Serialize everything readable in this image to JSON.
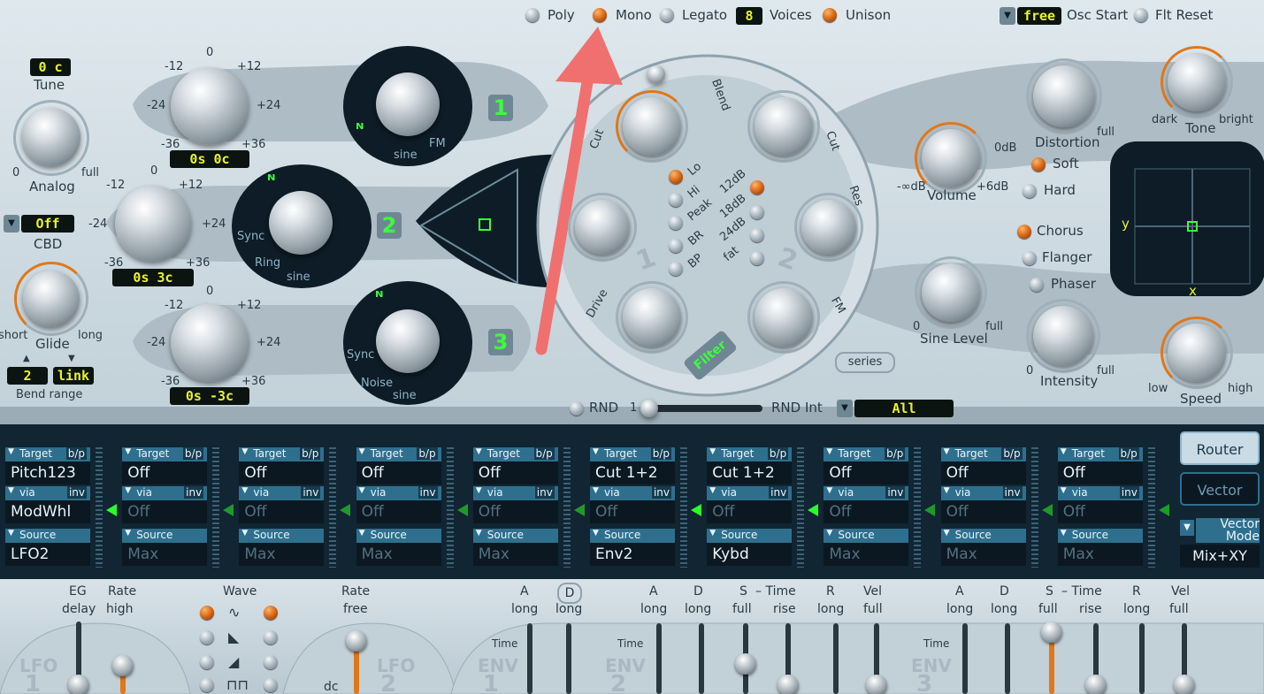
{
  "top_bar": {
    "poly": "Poly",
    "mono": "Mono",
    "legato": "Legato",
    "voices_value": "8",
    "voices_label": "Voices",
    "unison": "Unison",
    "osc_start_value": "free",
    "osc_start_label": "Osc Start",
    "flt_reset": "Flt Reset"
  },
  "left_panel": {
    "tune_value": "0 c",
    "tune_label": "Tune",
    "analog_label": "Analog",
    "analog_min": "0",
    "analog_max": "full",
    "cbd_value": "Off",
    "cbd_label": "CBD",
    "glide_label": "Glide",
    "glide_min": "short",
    "glide_max": "long",
    "bend_down": "2",
    "bend_up": "link",
    "bend_label": "Bend range"
  },
  "oscillators": {
    "osc1": {
      "number": "1",
      "readout": "0s  0c",
      "wave": "sine",
      "fm": "FM",
      "scale": [
        "-12",
        "0",
        "+12",
        "-24",
        "+24",
        "-36",
        "+36"
      ]
    },
    "osc2": {
      "number": "2",
      "readout": "0s  3c",
      "wave": "sine",
      "sync": "Sync",
      "ring": "Ring",
      "scale": [
        "-12",
        "0",
        "+12",
        "-24",
        "+24",
        "-36",
        "+36"
      ]
    },
    "osc3": {
      "number": "3",
      "readout": "0s  -3c",
      "wave": "sine",
      "sync": "Sync",
      "noise": "Noise",
      "scale": [
        "-12",
        "0",
        "+12",
        "-24",
        "+24",
        "-36",
        "+36"
      ]
    }
  },
  "filter": {
    "blend": "Blend",
    "cut1": "Cut",
    "cut2": "Cut",
    "res1": "Res",
    "res2": "Res",
    "drive": "Drive",
    "fm": "FM",
    "filter_badge": "Filter",
    "series": "series",
    "modes": [
      "Lo",
      "Hi",
      "Peak",
      "BR",
      "BP"
    ],
    "slopes": [
      "12dB",
      "18dB",
      "24dB",
      "fat"
    ],
    "num1": "1",
    "num2": "2"
  },
  "rnd": {
    "label": "RND",
    "min": "1",
    "int_label": "RND Int",
    "target": "All"
  },
  "right_panel": {
    "volume_label": "Volume",
    "volume_min": "-∞dB",
    "volume_mid": "0dB",
    "volume_max": "+6dB",
    "sine_level_label": "Sine Level",
    "sine_min": "0",
    "sine_max": "full",
    "distortion_label": "Distortion",
    "dist_max": "full",
    "soft": "Soft",
    "hard": "Hard",
    "tone_label": "Tone",
    "tone_min": "dark",
    "tone_max": "bright",
    "chorus": "Chorus",
    "flanger": "Flanger",
    "phaser": "Phaser",
    "intensity_label": "Intensity",
    "intensity_min": "0",
    "intensity_max": "full",
    "speed_label": "Speed",
    "speed_min": "low",
    "speed_max": "high",
    "xy_x": "x",
    "xy_y": "y"
  },
  "mod_matrix": {
    "header_target": "Target",
    "header_bp": "b/p",
    "header_via": "via",
    "header_inv": "inv",
    "header_source": "Source",
    "slots": [
      {
        "target": "Pitch123",
        "via": "ModWhl",
        "source": "LFO2",
        "active": true
      },
      {
        "target": "Off",
        "via": "Off",
        "source": "Max",
        "active": false
      },
      {
        "target": "Off",
        "via": "Off",
        "source": "Max",
        "active": false
      },
      {
        "target": "Off",
        "via": "Off",
        "source": "Max",
        "active": false
      },
      {
        "target": "Off",
        "via": "Off",
        "source": "Max",
        "active": false
      },
      {
        "target": "Cut 1+2",
        "via": "Off",
        "source": "Env2",
        "active": true
      },
      {
        "target": "Cut 1+2",
        "via": "Off",
        "source": "Kybd",
        "active": true
      },
      {
        "target": "Off",
        "via": "Off",
        "source": "Max",
        "active": false
      },
      {
        "target": "Off",
        "via": "Off",
        "source": "Max",
        "active": false
      },
      {
        "target": "Off",
        "via": "Off",
        "source": "Max",
        "active": false
      }
    ],
    "router": "Router",
    "vector": "Vector",
    "vector_mode_label": "Vector Mode",
    "vector_mode_value": "Mix+XY"
  },
  "bottom": {
    "lfo1": {
      "eg": "EG",
      "delay": "delay",
      "rate": "Rate",
      "high": "high",
      "label": "LFO",
      "num": "1"
    },
    "wave_label": "Wave",
    "lfo2": {
      "rate": "Rate",
      "free": "free",
      "label": "LFO",
      "num": "2",
      "dc": "dc"
    },
    "env1": {
      "a": "A",
      "a_sub": "long",
      "d": "D",
      "d_sub": "long",
      "label": "ENV",
      "num": "1",
      "time": "Time"
    },
    "env2": {
      "a": "A",
      "a_sub": "long",
      "d": "D",
      "d_sub": "long",
      "s": "S",
      "s_sub": "full",
      "time_hdr": "– Time",
      "rise": "rise",
      "r": "R",
      "r_sub": "long",
      "vel": "Vel",
      "vel_sub": "full",
      "label": "ENV",
      "num": "2",
      "time": "Time"
    },
    "env3": {
      "a": "A",
      "a_sub": "long",
      "d": "D",
      "d_sub": "long",
      "s": "S",
      "s_sub": "full",
      "time_hdr": "– Time",
      "rise": "rise",
      "r": "R",
      "r_sub": "long",
      "vel": "Vel",
      "vel_sub": "full",
      "label": "ENV",
      "num": "3",
      "time": "Time"
    }
  }
}
